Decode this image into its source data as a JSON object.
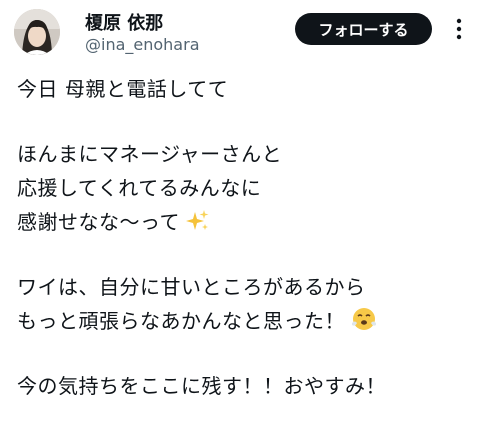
{
  "user": {
    "display_name": "榎原 依那",
    "handle": "@ina_enohara"
  },
  "actions": {
    "follow_label": "フォローする",
    "more_icon": "more-vertical-icon"
  },
  "tweet": {
    "paragraphs": [
      [
        "今日 母親と電話してて"
      ],
      [
        "ほんまにマネージャーさんと",
        "応援してくれてるみんなに",
        "感謝せなな〜って"
      ],
      [
        "ワイは、自分に甘いところがあるから",
        "もっと頑張らなあかんなと思った！"
      ],
      [
        "今の気持ちをここに残す！！おやすみ！"
      ]
    ],
    "emojis": {
      "sparkles": "sparkles-icon",
      "steam_face": "face-with-steam-icon"
    }
  }
}
